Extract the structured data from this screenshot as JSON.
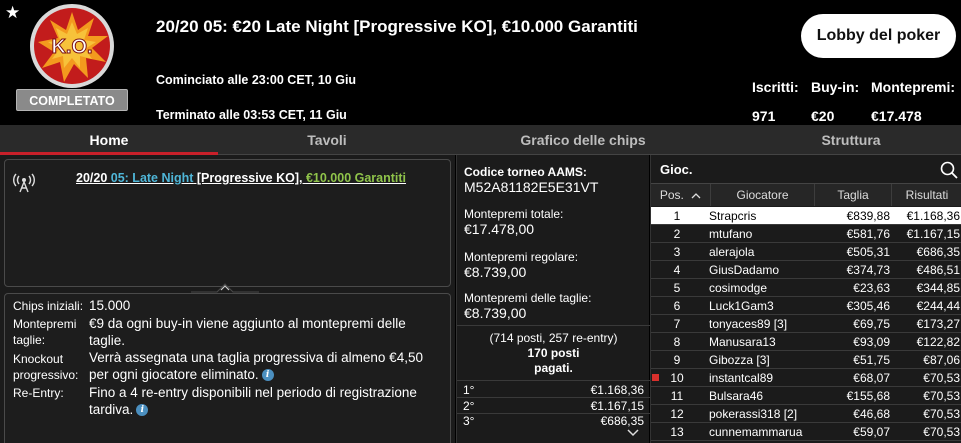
{
  "header": {
    "title": "20/20 05: €20 Late Night [Progressive KO], €10.000 Garantiti",
    "badge_text": "K.O.",
    "status": "COMPLETATO",
    "started": "Cominciato alle 23:00 CET, 10 Giu",
    "ended": "Terminato alle 03:53 CET, 11 Giu",
    "lobby_button": "Lobby del poker",
    "stats": [
      {
        "label": "Iscritti:",
        "value": "971"
      },
      {
        "label": "Buy-in:",
        "value": "€20"
      },
      {
        "label": "Montepremi:",
        "value": "€17.478"
      }
    ]
  },
  "tabs": [
    "Home",
    "Tavoli",
    "Grafico delle chips",
    "Struttura"
  ],
  "info": {
    "title_part1": "20/20 ",
    "title_part2": "05: Late Night",
    "title_part3": " [Progressive KO], ",
    "title_part4": "€10.000 Garantiti",
    "details": [
      {
        "label": "Chips iniziali:",
        "value": "15.000"
      },
      {
        "label": "Montepremi taglie:",
        "value": "€9 da ogni buy-in viene aggiunto al montepremi delle taglie."
      },
      {
        "label": "Knockout progressivo:",
        "value": "Verrà assegnata una taglia progressiva di almeno €4,50 per ogni giocatore eliminato."
      },
      {
        "label": "Re-Entry:",
        "value": "Fino a 4 re-entry disponibili nel periodo di registrazione tardiva."
      }
    ]
  },
  "summary": {
    "aams_label": "Codice torneo AAMS:",
    "aams_code": "M52A81182E5E31VT",
    "total_label": "Montepremi totale:",
    "total_value": "€17.478,00",
    "regular_label": "Montepremi regolare:",
    "regular_value": "€8.739,00",
    "bounty_label": "Montepremi delle taglie:",
    "bounty_value": "€8.739,00",
    "seats_line1": "(714 posti, 257 re-entry)",
    "seats_line2": "170 posti",
    "seats_line3": "pagati.",
    "prizes": [
      {
        "place": "1°",
        "amount": "€1.168,36"
      },
      {
        "place": "2°",
        "amount": "€1.167,15"
      },
      {
        "place": "3°",
        "amount": "€686,35"
      }
    ]
  },
  "players": {
    "search_label": "Gioc.",
    "columns": [
      "Pos.",
      "Giocatore",
      "Taglia",
      "Risultati"
    ],
    "rows": [
      {
        "pos": "1",
        "name": "Strapcris",
        "taglia": "€839,88",
        "ris": "€1.168,36",
        "highlight": true
      },
      {
        "pos": "2",
        "name": "mtufano",
        "taglia": "€581,76",
        "ris": "€1.167,15"
      },
      {
        "pos": "3",
        "name": "alerajola",
        "taglia": "€505,31",
        "ris": "€686,35"
      },
      {
        "pos": "4",
        "name": "GiusDadamo",
        "taglia": "€374,73",
        "ris": "€486,51"
      },
      {
        "pos": "5",
        "name": "cosimodge",
        "taglia": "€23,63",
        "ris": "€344,85"
      },
      {
        "pos": "6",
        "name": "Luck1Gam3",
        "taglia": "€305,46",
        "ris": "€244,44"
      },
      {
        "pos": "7",
        "name": "tonyaces89 [3]",
        "taglia": "€69,75",
        "ris": "€173,27"
      },
      {
        "pos": "8",
        "name": "Manusara13",
        "taglia": "€93,09",
        "ris": "€122,82"
      },
      {
        "pos": "9",
        "name": "Gibozza [3]",
        "taglia": "€51,75",
        "ris": "€87,06"
      },
      {
        "pos": "10",
        "name": "instantcal89",
        "taglia": "€68,07",
        "ris": "€70,53",
        "marker": true
      },
      {
        "pos": "11",
        "name": "Bulsara46",
        "taglia": "€155,68",
        "ris": "€70,53"
      },
      {
        "pos": "12",
        "name": "pokerassi318 [2]",
        "taglia": "€46,68",
        "ris": "€70,53"
      },
      {
        "pos": "13",
        "name": "cunnemammarua",
        "taglia": "€59,07",
        "ris": "€70,53"
      }
    ]
  },
  "colors": {
    "accent_red": "#c8202a",
    "link_blue": "#4fb6d8",
    "link_green": "#8fc34a",
    "badge_orange": "#e8502a"
  }
}
